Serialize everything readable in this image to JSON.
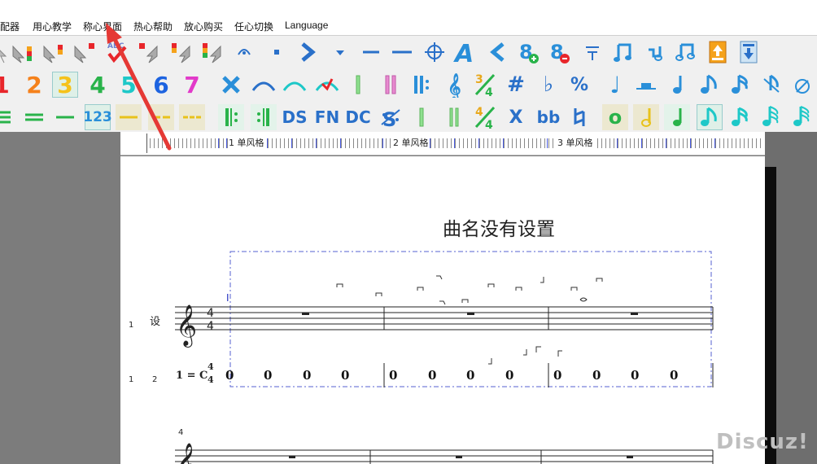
{
  "menu": [
    {
      "id": "menu-item-config",
      "label": "配器"
    },
    {
      "id": "menu-item-tutorial",
      "label": "用心教学"
    },
    {
      "id": "menu-item-interface",
      "label": "称心界面"
    },
    {
      "id": "menu-item-help",
      "label": "热心帮助"
    },
    {
      "id": "menu-item-buy",
      "label": "放心购买"
    },
    {
      "id": "menu-item-switch",
      "label": "任心切换"
    },
    {
      "id": "menu-item-language",
      "label": "Language"
    }
  ],
  "toolbar_row2": {
    "num1": "1",
    "num2": "2",
    "num3": "3",
    "num4": "4",
    "num5": "5",
    "num6": "6",
    "num7": "7",
    "sharp": "#",
    "flat": "♭",
    "percent": "%",
    "quarter_note": "♩"
  },
  "toolbar_row3": {
    "n123": "123",
    "ds": "DS",
    "fn": "FN",
    "dc": "DC",
    "x": "X",
    "bb": "bb",
    "whole": "o",
    "frac_num": "4",
    "frac_den": "4",
    "ts_num": "3",
    "ts_den": "4"
  },
  "ruler": {
    "labels": [
      "1 单风格",
      "2 单风格",
      "3 单风格"
    ]
  },
  "score": {
    "title": "曲名没有设置",
    "staff_number": "1",
    "staff_number2": "1",
    "staff_number3": "2",
    "system2_number": "4",
    "voice_label": "设",
    "key_signature": "1 = C",
    "time_sig_top": "4",
    "time_sig_bottom": "4",
    "rest_measures": [
      [
        "0",
        "0",
        "0",
        "0"
      ],
      [
        "0",
        "0",
        "0",
        "0"
      ],
      [
        "0",
        "0",
        "0",
        "0"
      ]
    ],
    "cursor_mark": "I"
  },
  "watermark": "Discuz!",
  "colors": {
    "arrow": "#e53935",
    "selection": "#4a5be0",
    "red": "#e8262b",
    "orange": "#f5a21b",
    "green": "#29b34a",
    "cyan": "#1ec8c8",
    "blue": "#1d63e0",
    "magenta": "#e23ac9"
  }
}
